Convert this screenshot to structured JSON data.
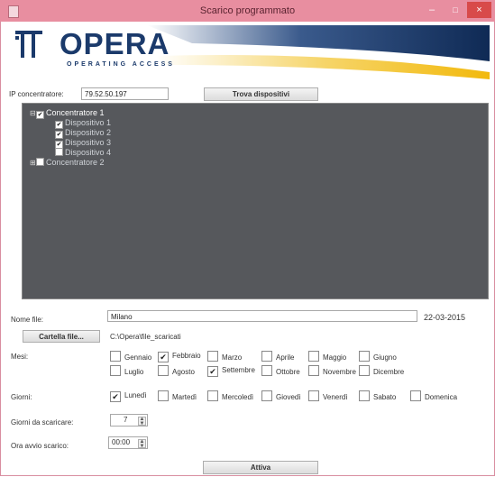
{
  "window": {
    "title": "Scarico programmato",
    "controls": {
      "minimize": "–",
      "maximize": "□",
      "close": "×"
    }
  },
  "logo": {
    "name": "OPERA",
    "subtitle": "OPERATING ACCESS",
    "colors": {
      "navy": "#1b3a6b",
      "gold": "#f2c21c"
    }
  },
  "concentrator": {
    "label": "IP concentratore:",
    "value": "79.52.50.197",
    "search_button": "Trova dispositivi"
  },
  "tree": [
    {
      "label": "Concentratore 1",
      "checked": true,
      "expanded": true,
      "children": [
        {
          "label": "Dispositivo 1",
          "checked": true
        },
        {
          "label": "Dispositivo 2",
          "checked": true
        },
        {
          "label": "Dispositivo 3",
          "checked": true
        },
        {
          "label": "Dispositivo 4",
          "checked": false
        }
      ]
    },
    {
      "label": "Concentratore 2",
      "checked": false,
      "expanded": false,
      "children": []
    }
  ],
  "file": {
    "label": "Nome file:",
    "value": "Milano",
    "date": "22-03-2015"
  },
  "folder": {
    "button": "Cartella file...",
    "path": "C:\\Opera\\file_scaricati"
  },
  "months": {
    "label": "Mesi:",
    "items": [
      {
        "label": "Gennaio",
        "checked": false
      },
      {
        "label": "Febbraio",
        "checked": true
      },
      {
        "label": "Marzo",
        "checked": false
      },
      {
        "label": "Aprile",
        "checked": false
      },
      {
        "label": "Maggio",
        "checked": false
      },
      {
        "label": "Giugno",
        "checked": false
      },
      {
        "label": "Luglio",
        "checked": false
      },
      {
        "label": "Agosto",
        "checked": false
      },
      {
        "label": "Settembre",
        "checked": true
      },
      {
        "label": "Ottobre",
        "checked": false
      },
      {
        "label": "Novembre",
        "checked": false
      },
      {
        "label": "Dicembre",
        "checked": false
      }
    ]
  },
  "days": {
    "label": "Giorni:",
    "items": [
      {
        "label": "Lunedì",
        "checked": true
      },
      {
        "label": "Martedì",
        "checked": false
      },
      {
        "label": "Mercoledì",
        "checked": false
      },
      {
        "label": "Giovedì",
        "checked": false
      },
      {
        "label": "Venerdì",
        "checked": false
      },
      {
        "label": "Sabato",
        "checked": false
      },
      {
        "label": "Domenica",
        "checked": false
      }
    ]
  },
  "days_to_download": {
    "label": "Giorni da scaricare:",
    "value": "7"
  },
  "start_time": {
    "label": "Ora avvio scarico:",
    "value": "00:00"
  },
  "activate_button": "Attiva",
  "check_mark": "✔"
}
